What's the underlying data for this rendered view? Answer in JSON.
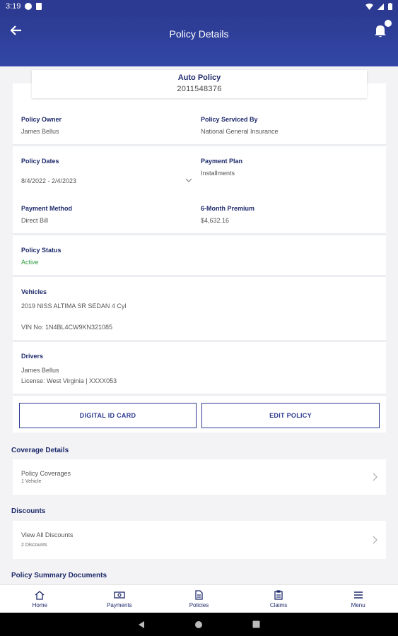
{
  "status_bar": {
    "time": "3:19"
  },
  "app_bar": {
    "title": "Policy Details"
  },
  "policy_header": {
    "type": "Auto Policy",
    "number": "2011548376"
  },
  "owner": {
    "owner_label": "Policy Owner",
    "owner_value": "James Bellus",
    "serviced_label": "Policy Serviced By",
    "serviced_value": "National General Insurance"
  },
  "dates": {
    "dates_label": "Policy Dates",
    "dates_value": "8/4/2022 - 2/4/2023",
    "plan_label": "Payment Plan",
    "plan_value": "Installments",
    "method_label": "Payment Method",
    "method_value": "Direct Bill",
    "premium_label": "6-Month Premium",
    "premium_value": "$4,632.16"
  },
  "status": {
    "label": "Policy Status",
    "value": "Active",
    "value_color": "#2e9e3f"
  },
  "vehicles": {
    "label": "Vehicles",
    "vehicle": "2019 NISS ALTIMA SR SEDAN 4 Cyl",
    "vin": "VIN No: 1N4BL4CW9KN321085"
  },
  "drivers": {
    "label": "Drivers",
    "name": "James Bellus",
    "license": "License: West Virginia | XXXX053"
  },
  "buttons": {
    "id_card": "DIGITAL ID CARD",
    "edit": "EDIT POLICY"
  },
  "coverage": {
    "section_title": "Coverage Details",
    "row_title": "Policy Coverages",
    "row_sub": "1 Vehicle"
  },
  "discounts": {
    "section_title": "Discounts",
    "row_title": "View All Discounts",
    "row_sub": "2 Discounts"
  },
  "documents": {
    "section_title": "Policy Summary Documents"
  },
  "bottom_nav": {
    "home": "Home",
    "payments": "Payments",
    "policies": "Policies",
    "claims": "Claims",
    "menu": "Menu"
  },
  "colors": {
    "brand": "#2c3a91",
    "label": "#1d2a6b",
    "active": "#2e9e3f"
  }
}
